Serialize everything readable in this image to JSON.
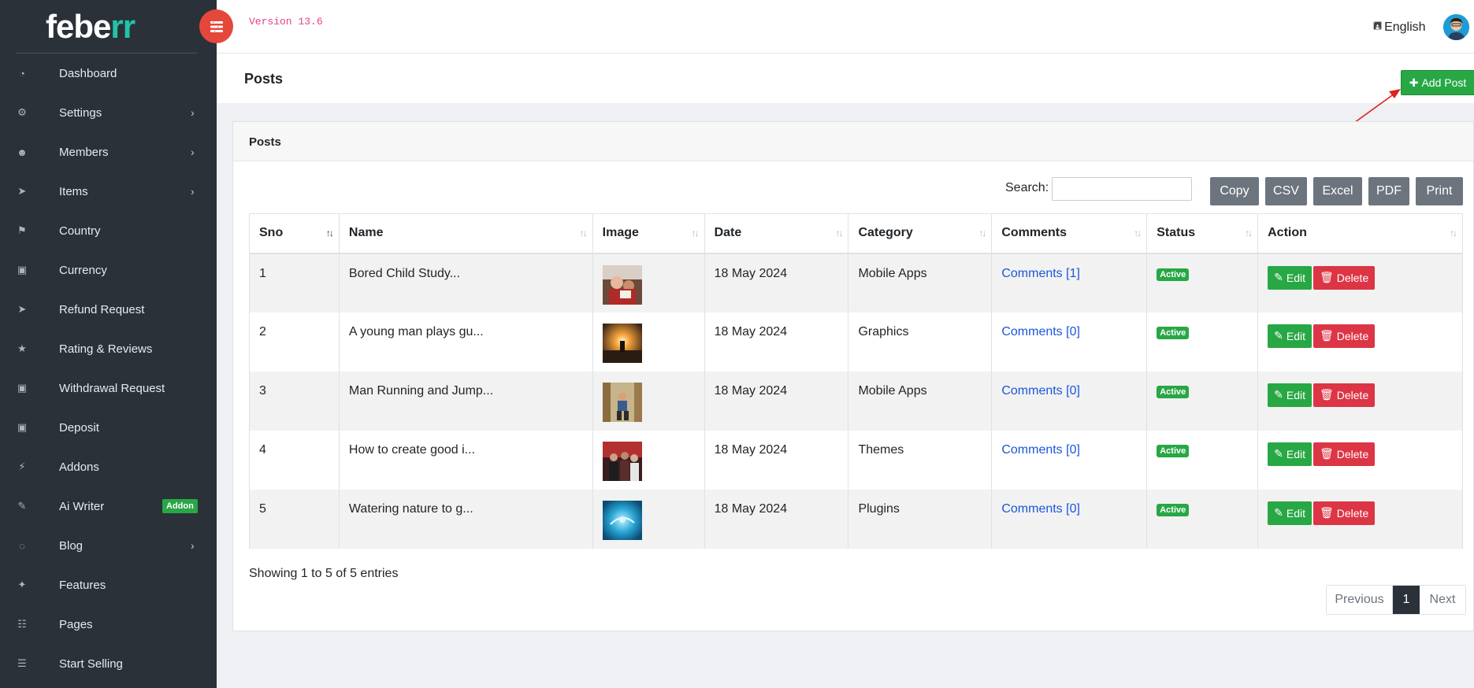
{
  "brand": {
    "part1": "febe",
    "part2": "rr"
  },
  "version": "Version 13.6",
  "language": "English",
  "sidebar": {
    "items": [
      {
        "label": "Dashboard",
        "icon": "dashboard-icon",
        "has_submenu": false
      },
      {
        "label": "Settings",
        "icon": "cogs-icon",
        "has_submenu": true
      },
      {
        "label": "Members",
        "icon": "users-icon",
        "has_submenu": true
      },
      {
        "label": "Items",
        "icon": "location-arrow-icon",
        "has_submenu": true
      },
      {
        "label": "Country",
        "icon": "flag-icon",
        "has_submenu": false
      },
      {
        "label": "Currency",
        "icon": "money-icon",
        "has_submenu": false
      },
      {
        "label": "Refund Request",
        "icon": "paper-plane-icon",
        "has_submenu": false
      },
      {
        "label": "Rating & Reviews",
        "icon": "star-icon",
        "has_submenu": false
      },
      {
        "label": "Withdrawal Request",
        "icon": "money-icon",
        "has_submenu": false
      },
      {
        "label": "Deposit",
        "icon": "money-icon",
        "has_submenu": false
      },
      {
        "label": "Addons",
        "icon": "plug-icon",
        "has_submenu": false
      },
      {
        "label": "Ai Writer",
        "icon": "edit-icon",
        "has_submenu": false,
        "badge": "Addon"
      },
      {
        "label": "Blog",
        "icon": "comments-icon",
        "has_submenu": true
      },
      {
        "label": "Features",
        "icon": "magic-icon",
        "has_submenu": false
      },
      {
        "label": "Pages",
        "icon": "file-icon",
        "has_submenu": false
      },
      {
        "label": "Start Selling",
        "icon": "cart-icon",
        "has_submenu": false
      }
    ]
  },
  "page": {
    "title": "Posts",
    "add_button": "Add Post"
  },
  "card": {
    "title": "Posts"
  },
  "search": {
    "label": "Search:",
    "value": ""
  },
  "export_buttons": [
    "Copy",
    "CSV",
    "Excel",
    "PDF",
    "Print"
  ],
  "table": {
    "columns": [
      "Sno",
      "Name",
      "Image",
      "Date",
      "Category",
      "Comments",
      "Status",
      "Action"
    ],
    "rows": [
      {
        "sno": "1",
        "name": "Bored Child Study...",
        "date": "18 May 2024",
        "category": "Mobile Apps",
        "comments": "Comments [1]",
        "status": "Active"
      },
      {
        "sno": "2",
        "name": "A young man plays gu...",
        "date": "18 May 2024",
        "category": "Graphics",
        "comments": "Comments [0]",
        "status": "Active"
      },
      {
        "sno": "3",
        "name": "Man Running and Jump...",
        "date": "18 May 2024",
        "category": "Mobile Apps",
        "comments": "Comments [0]",
        "status": "Active"
      },
      {
        "sno": "4",
        "name": "How to create good i...",
        "date": "18 May 2024",
        "category": "Themes",
        "comments": "Comments [0]",
        "status": "Active"
      },
      {
        "sno": "5",
        "name": "Watering nature to g...",
        "date": "18 May 2024",
        "category": "Plugins",
        "comments": "Comments [0]",
        "status": "Active"
      }
    ],
    "edit_label": "Edit",
    "delete_label": "Delete"
  },
  "footer": {
    "showing": "Showing 1 to 5 of 5 entries",
    "prev": "Previous",
    "current": "1",
    "next": "Next"
  },
  "colors": {
    "sidebar_bg": "#2a3139",
    "brand_accent": "#22c3a9",
    "primary_green": "#28a745",
    "danger_red": "#dc3545",
    "hamburger_red": "#e5473b",
    "link_blue": "#1a56db"
  }
}
